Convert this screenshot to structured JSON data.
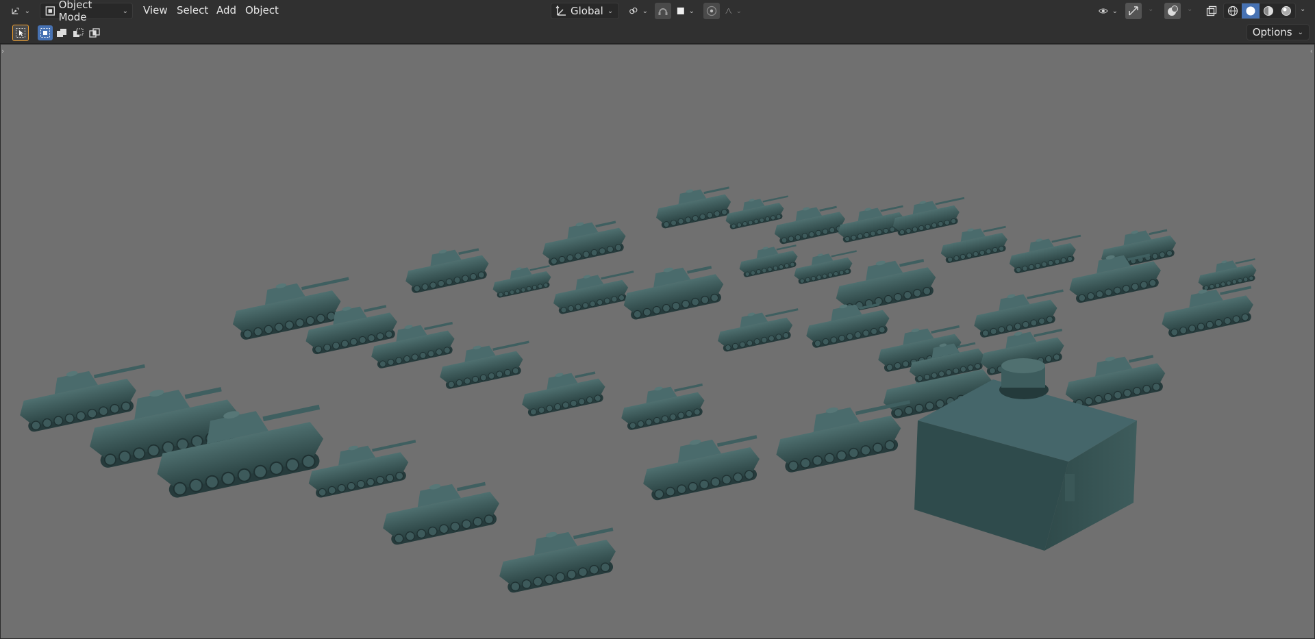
{
  "header": {
    "editor_type_icon": "3d-viewport-icon",
    "mode": {
      "label": "Object Mode",
      "icon": "object-mode-icon"
    },
    "menus": [
      "View",
      "Select",
      "Add",
      "Object"
    ],
    "transform_orientation": {
      "label": "Global",
      "icon": "transform-orientation-icon"
    },
    "pivot_icon": "pivot-point-icon",
    "snap_icon": "snap-icon",
    "snap_target_icon": "snap-increment-icon",
    "proportional_icon": "proportional-editing-icon",
    "falloff_icon": "falloff-curve-icon",
    "visibility_icon": "visibility-icon",
    "gizmo_icon": "gizmo-icon",
    "overlay_icon": "overlay-icon",
    "xray_icon": "xray-icon",
    "shading_modes": [
      "wireframe",
      "solid",
      "material-preview",
      "rendered"
    ],
    "active_shading": "solid"
  },
  "toolbar": {
    "select_tool_icon": "select-box-tool-icon",
    "selection_modes": [
      "new-selection",
      "extend-selection",
      "subtract-selection",
      "invert-selection"
    ],
    "options_label": "Options"
  },
  "viewport": {
    "background": "#707070",
    "object_color": "#3d5a5a",
    "scene_description": "3d-vehicle-models"
  },
  "colors": {
    "header_bg": "#303030",
    "button_bg": "#282828",
    "accent_blue": "#4772b3",
    "text": "#e6e6e6"
  }
}
